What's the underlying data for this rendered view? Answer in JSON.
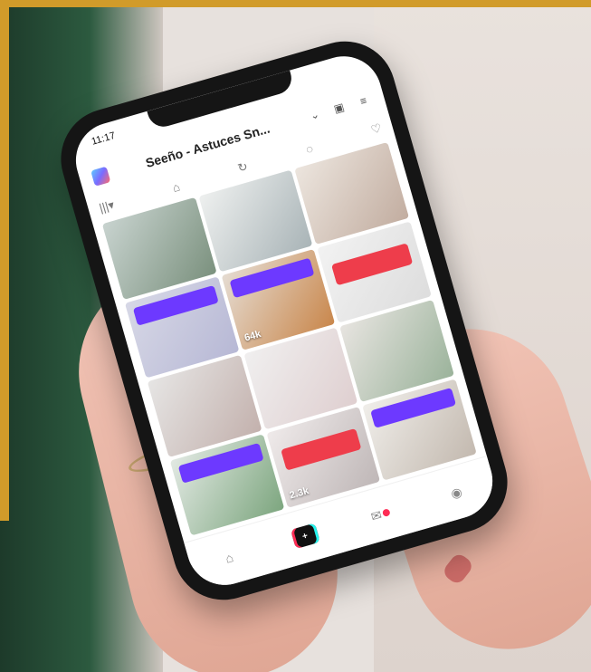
{
  "status": {
    "time": "11:17"
  },
  "header": {
    "title": "Seeño - Astuces Sn..."
  },
  "tabs": [
    {
      "label": "|||▾"
    },
    {
      "label": "⌂"
    },
    {
      "label": "↻"
    },
    {
      "label": "◌"
    },
    {
      "label": "♡"
    }
  ],
  "grid": {
    "counts": [
      "",
      "",
      "",
      "",
      "64k",
      "",
      "",
      "",
      "",
      "",
      "2.3k",
      ""
    ]
  },
  "bottom_nav": [
    {
      "label": ""
    },
    {
      "label": "+"
    },
    {
      "label": ""
    },
    {
      "label": ""
    }
  ],
  "colors": {
    "accent": "#6d39ff",
    "badge": "#ee3d4b",
    "tiktok_red": "#fe2c55",
    "tiktok_cyan": "#25f4ee"
  }
}
